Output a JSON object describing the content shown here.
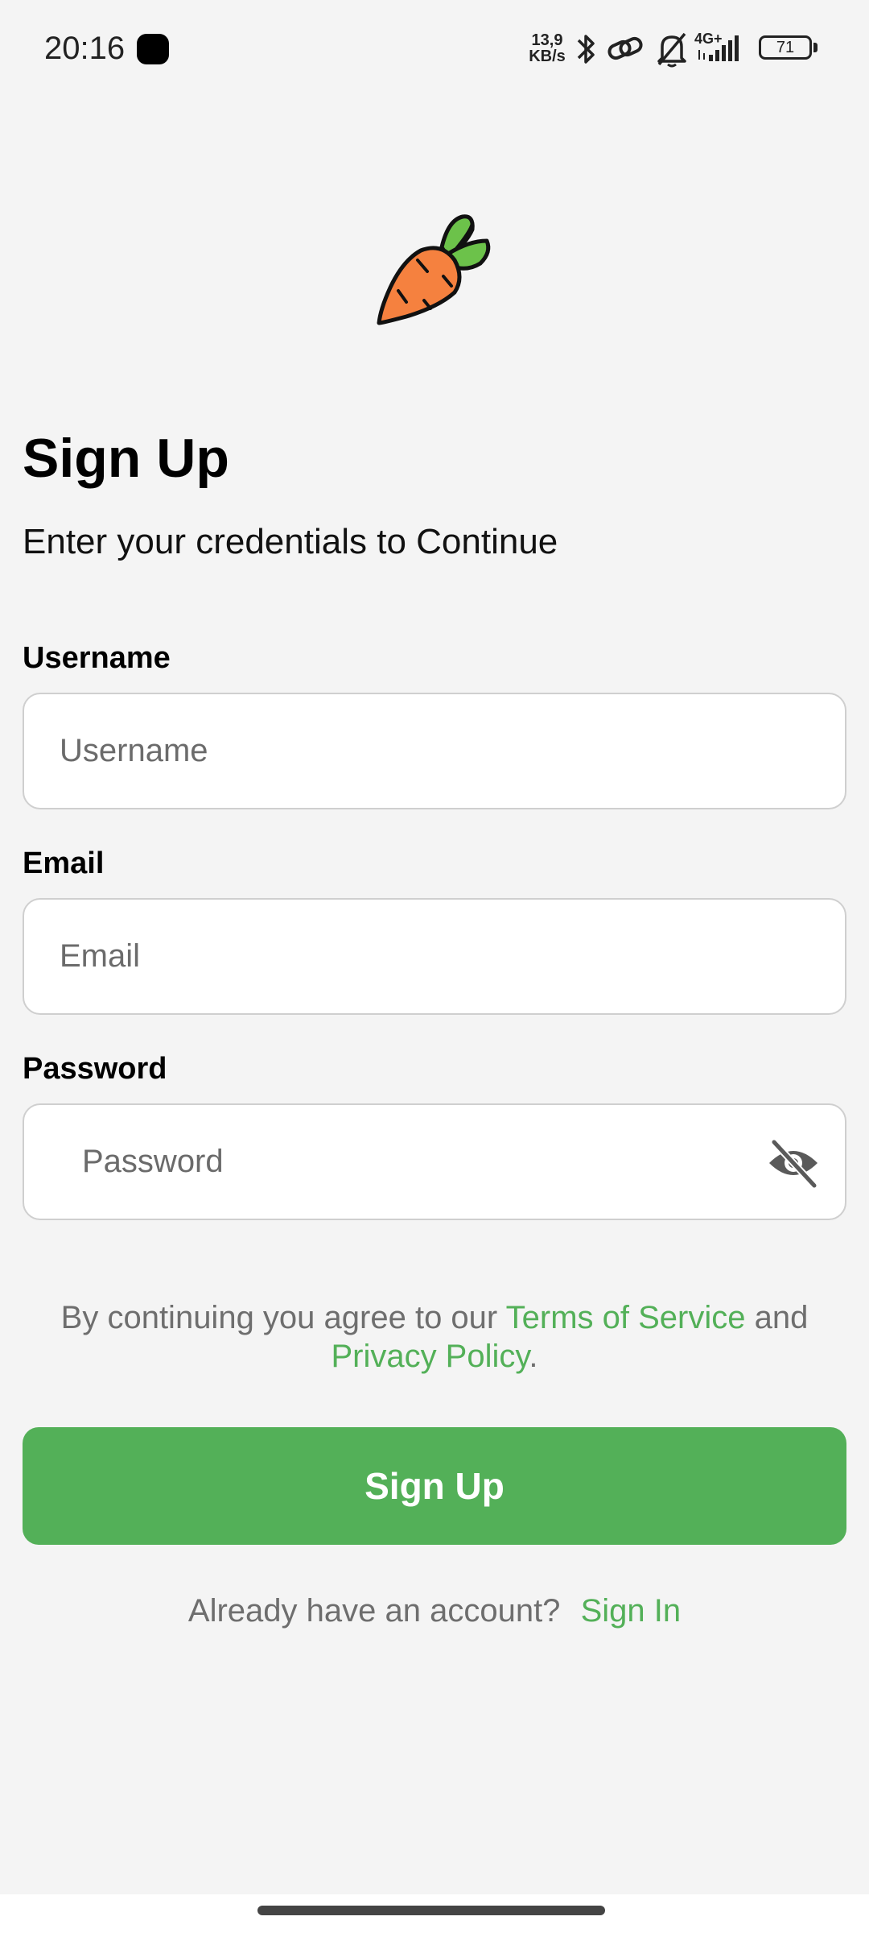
{
  "status_bar": {
    "time": "20:16",
    "net_speed_value": "13,9",
    "net_speed_unit": "KB/s",
    "network_type": "4G+",
    "battery": "71",
    "icons": [
      "bluetooth-icon",
      "link-icon",
      "bell-off-icon",
      "signal-icon",
      "battery-icon"
    ]
  },
  "logo": {
    "icon": "carrot-icon"
  },
  "header": {
    "title": "Sign Up",
    "subtitle": "Enter your credentials to Continue"
  },
  "form": {
    "username": {
      "label": "Username",
      "placeholder": "Username",
      "value": ""
    },
    "email": {
      "label": "Email",
      "placeholder": "Email",
      "value": ""
    },
    "password": {
      "label": "Password",
      "placeholder": "Password",
      "value": "",
      "toggle_icon": "eye-off-icon"
    }
  },
  "terms": {
    "prefix": "By continuing you agree to our ",
    "terms_link": "Terms of Service",
    "middle": " and",
    "privacy_link": "Privacy Policy",
    "suffix": "."
  },
  "actions": {
    "signup_label": "Sign Up",
    "signin_prompt": "Already have an account?",
    "signin_link": "Sign In"
  },
  "colors": {
    "accent": "#53b058",
    "background": "#f4f4f4",
    "muted_text": "#6e6e6e",
    "carrot": "#f5813f",
    "carrot_leaves": "#6cc24a"
  }
}
